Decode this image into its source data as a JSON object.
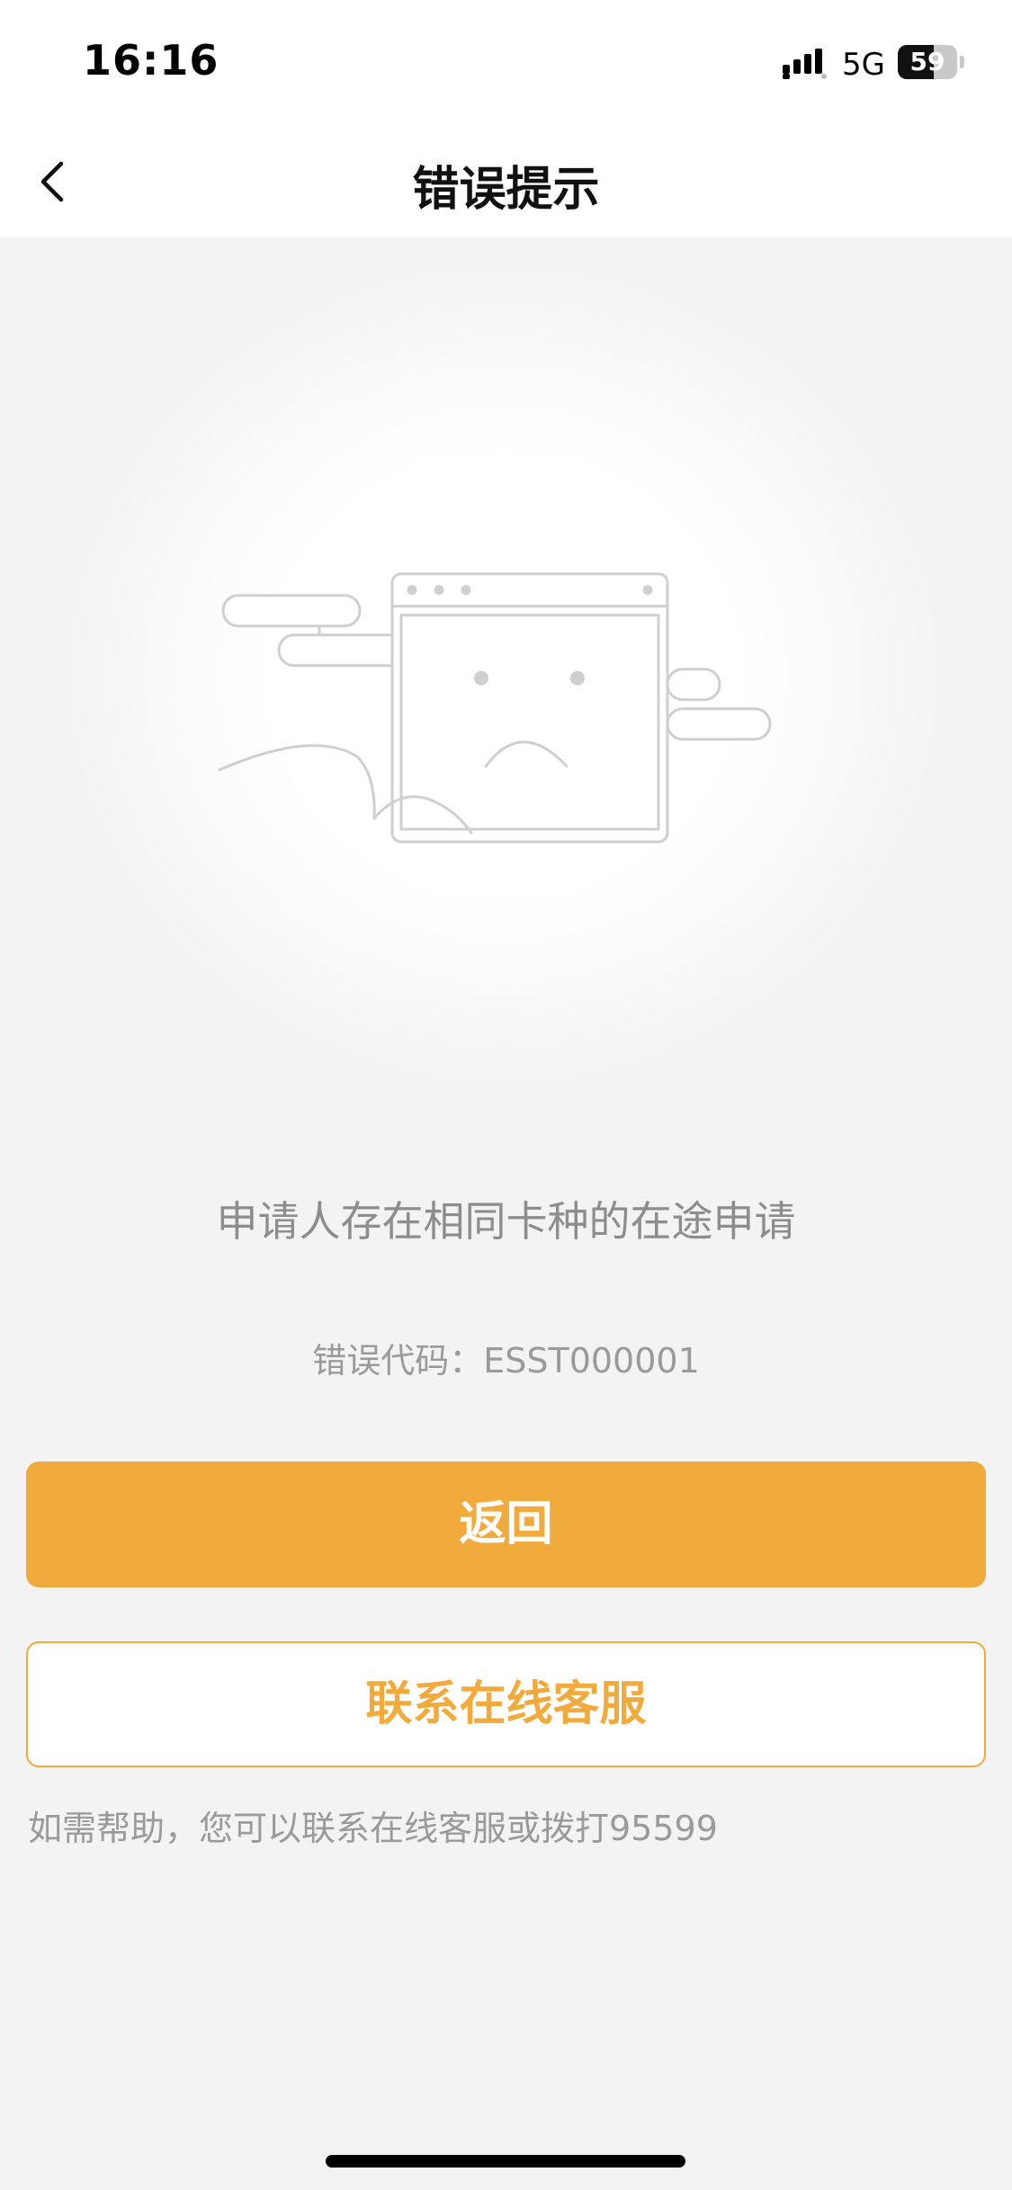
{
  "status_bar": {
    "time": "16:16",
    "network": "5G",
    "battery": "59",
    "signal_icon": "signal-bars-icon"
  },
  "nav": {
    "title": "错误提示",
    "back_icon": "chevron-left-icon"
  },
  "illustration": {
    "icon": "sad-browser-window-illustration"
  },
  "error": {
    "message": "申请人存在相同卡种的在途申请",
    "code_label": "错误代码：",
    "code_value": "ESST000001"
  },
  "buttons": {
    "back_label": "返回",
    "contact_label": "联系在线客服"
  },
  "help": {
    "text": "如需帮助，您可以联系在线客服或拨打95599"
  },
  "colors": {
    "accent": "#f0ab3c",
    "background": "#f3f3f3",
    "text_muted": "#8d8d8d"
  }
}
